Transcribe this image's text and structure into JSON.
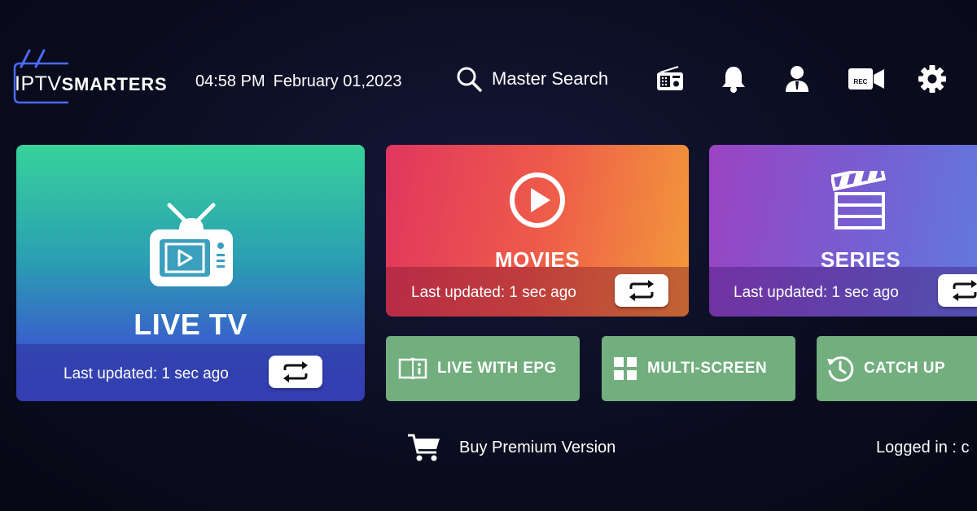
{
  "header": {
    "logo": {
      "prefix": "IPTV",
      "name": "SMARTERS"
    },
    "time": "04:58 PM",
    "date": "February 01,2023",
    "search_label": "Master Search",
    "icons": [
      "radio-icon",
      "bell-icon",
      "user-icon",
      "rec-camera-icon",
      "gear-icon"
    ],
    "rec_badge": "REC"
  },
  "tiles": {
    "live_tv": {
      "title": "LIVE TV",
      "updated": "Last updated: 1 sec ago",
      "icon": "tv-icon"
    },
    "movies": {
      "title": "MOVIES",
      "updated": "Last updated: 1 sec ago",
      "icon": "play-circle-icon"
    },
    "series": {
      "title": "SERIES",
      "updated": "Last updated: 1 sec ago",
      "icon": "clapperboard-icon"
    }
  },
  "quick_tiles": [
    {
      "label": "LIVE WITH EPG",
      "icon": "epg-book-icon"
    },
    {
      "label": "MULTI-SCREEN",
      "icon": "grid-icon"
    },
    {
      "label": "CATCH UP",
      "icon": "history-icon"
    }
  ],
  "footer": {
    "buy_label": "Buy Premium Version",
    "logged_in": "Logged in : c"
  },
  "colors": {
    "background": "#0b0d1f",
    "quick_tile": "#72ae7e",
    "live_tv_top": "#37d29b",
    "live_tv_bottom": "#3f4fd0",
    "movies_left": "#e0365e",
    "movies_right": "#f29a3a",
    "series_left": "#9b43c2",
    "series_right": "#5d7fe0"
  }
}
